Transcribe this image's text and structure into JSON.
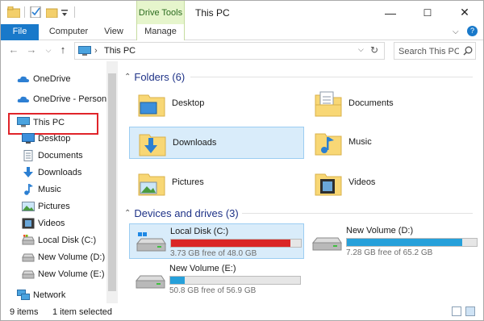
{
  "window": {
    "title": "This PC",
    "context_tab": "Drive Tools",
    "controls": {
      "minimize": "—",
      "maximize": "☐",
      "close": "✕"
    }
  },
  "ribbon": {
    "tabs": [
      "File",
      "Computer",
      "View",
      "Manage"
    ],
    "accent": "#1979ca",
    "context_color": "#e6f5cc"
  },
  "address": {
    "chevron": "›",
    "location": "This PC",
    "dropdown": "⌵",
    "refresh": "↻"
  },
  "search": {
    "placeholder": "Search This PC"
  },
  "nav": {
    "back": "←",
    "forward": "→",
    "recent": "⌵",
    "up": "↑",
    "items": [
      {
        "label": "OneDrive",
        "icon": "cloud-icon"
      },
      {
        "label": "OneDrive - Personal",
        "icon": "cloud-icon"
      },
      {
        "label": "This PC",
        "icon": "computer-icon"
      },
      {
        "label": "Desktop",
        "icon": "desktop-icon"
      },
      {
        "label": "Documents",
        "icon": "documents-icon"
      },
      {
        "label": "Downloads",
        "icon": "downloads-icon"
      },
      {
        "label": "Music",
        "icon": "music-icon"
      },
      {
        "label": "Pictures",
        "icon": "pictures-icon"
      },
      {
        "label": "Videos",
        "icon": "videos-icon"
      },
      {
        "label": "Local Disk (C:)",
        "icon": "drive-icon"
      },
      {
        "label": "New Volume (D:)",
        "icon": "drive-icon"
      },
      {
        "label": "New Volume (E:)",
        "icon": "drive-icon"
      },
      {
        "label": "Network",
        "icon": "network-icon"
      }
    ]
  },
  "folders": {
    "header": "Folders (6)",
    "items": [
      {
        "label": "Desktop",
        "icon": "desktop-folder-icon"
      },
      {
        "label": "Documents",
        "icon": "documents-folder-icon"
      },
      {
        "label": "Downloads",
        "icon": "downloads-folder-icon"
      },
      {
        "label": "Music",
        "icon": "music-folder-icon"
      },
      {
        "label": "Pictures",
        "icon": "pictures-folder-icon"
      },
      {
        "label": "Videos",
        "icon": "videos-folder-icon"
      }
    ]
  },
  "drives": {
    "header": "Devices and drives (3)",
    "items": [
      {
        "label": "Local Disk (C:)",
        "free": "3.73 GB free of 48.0 GB",
        "used_fraction": 0.92,
        "color": "#da2626"
      },
      {
        "label": "New Volume (D:)",
        "free": "7.28 GB free of 65.2 GB",
        "used_fraction": 0.89,
        "color": "#26a0da"
      },
      {
        "label": "New Volume (E:)",
        "free": "50.8 GB free of 56.9 GB",
        "used_fraction": 0.11,
        "color": "#26a0da"
      }
    ]
  },
  "status": {
    "count": "9 items",
    "selection": "1 item selected"
  }
}
